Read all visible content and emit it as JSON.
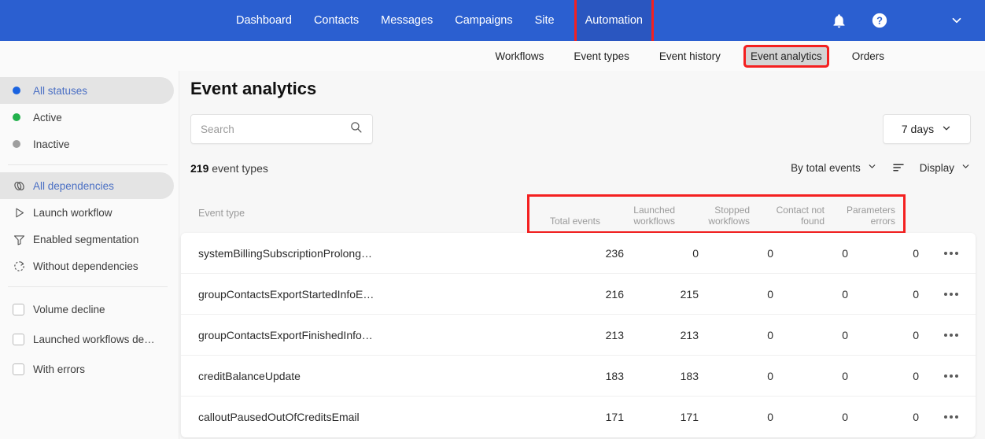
{
  "topnav": {
    "items": [
      {
        "label": "Dashboard",
        "active": false
      },
      {
        "label": "Contacts",
        "active": false
      },
      {
        "label": "Messages",
        "active": false
      },
      {
        "label": "Campaigns",
        "active": false
      },
      {
        "label": "Site",
        "active": false
      },
      {
        "label": "Automation",
        "active": true,
        "highlighted": true
      }
    ],
    "icons": [
      "bell-icon",
      "help-circle-icon",
      "chevron-down-icon"
    ]
  },
  "subnav": {
    "items": [
      {
        "label": "Workflows",
        "active": false
      },
      {
        "label": "Event types",
        "active": false
      },
      {
        "label": "Event history",
        "active": false
      },
      {
        "label": "Event analytics",
        "active": true,
        "highlighted": true
      },
      {
        "label": "Orders",
        "active": false
      }
    ]
  },
  "sidebar": {
    "statuses": [
      {
        "label": "All statuses",
        "icon": "status-dot",
        "color": "#1a63e0",
        "selected": true
      },
      {
        "label": "Active",
        "icon": "status-dot",
        "color": "#22b14c",
        "selected": false
      },
      {
        "label": "Inactive",
        "icon": "status-dot",
        "color": "#9e9e9e",
        "selected": false
      }
    ],
    "dependencies": [
      {
        "label": "All dependencies",
        "icon": "links-icon",
        "selected": true
      },
      {
        "label": "Launch workflow",
        "icon": "play-triangle-icon",
        "selected": false
      },
      {
        "label": "Enabled segmentation",
        "icon": "funnel-icon",
        "selected": false
      },
      {
        "label": "Without dependencies",
        "icon": "dashed-refresh-icon",
        "selected": false
      }
    ],
    "filters": [
      {
        "label": "Volume decline",
        "checked": false
      },
      {
        "label": "Launched workflows de…",
        "checked": false
      },
      {
        "label": "With errors",
        "checked": false
      }
    ]
  },
  "main": {
    "title": "Event analytics",
    "search": {
      "value": "",
      "placeholder": "Search",
      "icon": "search-icon"
    },
    "days_filter": {
      "label": "7 days",
      "icon": "chevron-down-icon"
    },
    "count": {
      "number": "219",
      "label": "event types"
    },
    "controls": {
      "sort_by": "By total events",
      "sort_icon": "sort-descending-icon",
      "display": "Display"
    },
    "table": {
      "col_event_type": "Event type",
      "columns": [
        "Total events",
        "Launched workflows",
        "Stopped workflows",
        "Contact not found",
        "Parameters errors"
      ],
      "rows": [
        {
          "name": "systemBillingSubscriptionProlong…",
          "total": "236",
          "launched": "0",
          "stopped": "0",
          "not_found": "0",
          "param_errors": "0",
          "menu": "more-options-icon"
        },
        {
          "name": "groupContactsExportStartedInfoE…",
          "total": "216",
          "launched": "215",
          "stopped": "0",
          "not_found": "0",
          "param_errors": "0",
          "menu": "more-options-icon"
        },
        {
          "name": "groupContactsExportFinishedInfo…",
          "total": "213",
          "launched": "213",
          "stopped": "0",
          "not_found": "0",
          "param_errors": "0",
          "menu": "more-options-icon"
        },
        {
          "name": "creditBalanceUpdate",
          "total": "183",
          "launched": "183",
          "stopped": "0",
          "not_found": "0",
          "param_errors": "0",
          "menu": "more-options-icon"
        },
        {
          "name": "calloutPausedOutOfCreditsEmail",
          "total": "171",
          "launched": "171",
          "stopped": "0",
          "not_found": "0",
          "param_errors": "0",
          "menu": "more-options-icon"
        }
      ]
    }
  },
  "colors": {
    "brand_blue": "#2b5fd0",
    "annotation_red": "#f42020",
    "selected_text": "#4a6fc4"
  }
}
